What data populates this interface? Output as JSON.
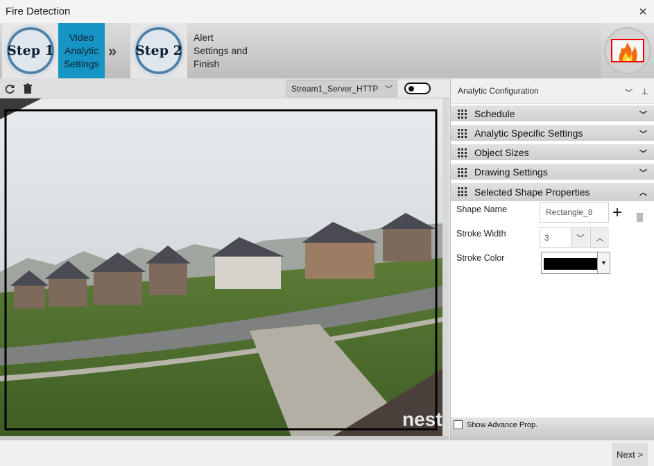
{
  "window": {
    "title": "Fire Detection",
    "close_glyph": "✕"
  },
  "wizard": {
    "step1_badge": "Step 1",
    "step1_label": "Video Analytic Settings",
    "step2_badge": "Step 2",
    "step2_label": "Alert Settings and Finish",
    "separator_icon": "double-chevron-right-icon",
    "app_icon": "fire-icon"
  },
  "video_toolbar": {
    "refresh_icon": "refresh-icon",
    "delete_icon": "trash-icon",
    "stream_value": "Stream1_Server_HTTP",
    "toggle_state": "off"
  },
  "video": {
    "watermark": "nest"
  },
  "analytic_panel": {
    "title": "Analytic Configuration",
    "sections": [
      {
        "label": "Schedule",
        "expanded": false
      },
      {
        "label": "Analytic Specific Settings",
        "expanded": false
      },
      {
        "label": "Object Sizes",
        "expanded": false
      },
      {
        "label": "Drawing Settings",
        "expanded": false
      },
      {
        "label": "Selected Shape Properties",
        "expanded": true
      }
    ],
    "shape_props": {
      "shape_name_label": "Shape Name",
      "shape_name_value": "Rectangle_8",
      "stroke_width_label": "Stroke Width",
      "stroke_width_value": "3",
      "stroke_color_label": "Stroke Color",
      "stroke_color_value": "#000000"
    },
    "show_advance_label": "Show Advance Prop."
  },
  "footer": {
    "next_label": "Next >"
  }
}
